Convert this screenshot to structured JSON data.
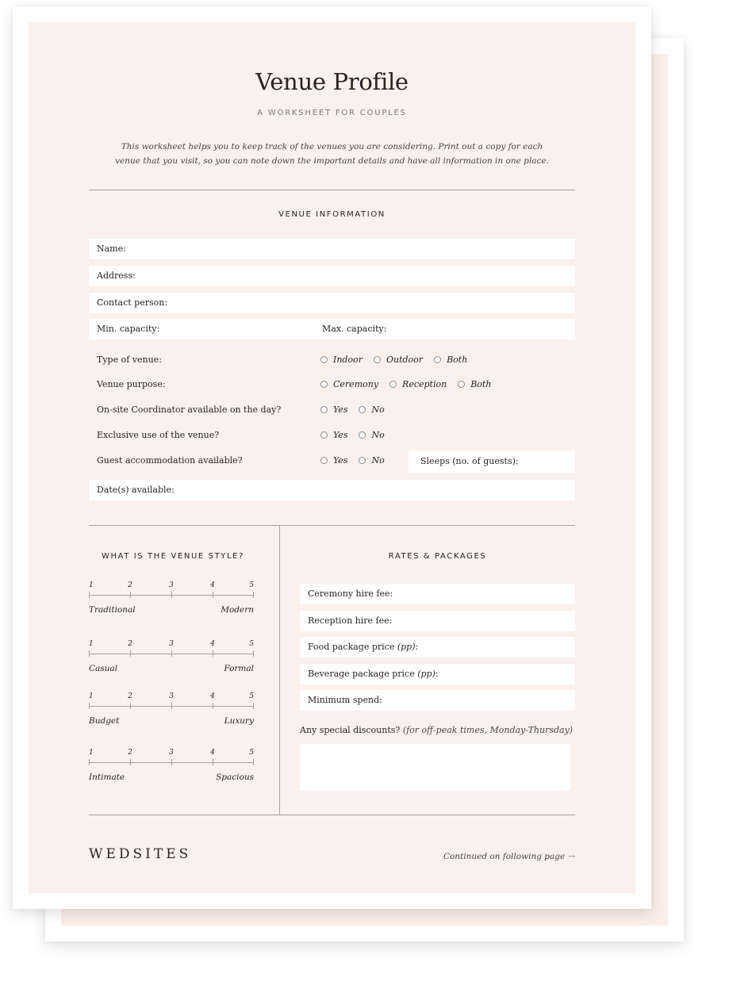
{
  "document": {
    "title": "Venue Profile",
    "subtitle": "A WORKSHEET FOR COUPLES",
    "intro": "This worksheet helps you to keep track of the venues you are considering. Print out a copy for each venue that you visit, so you can note down the important details and have all information in one place."
  },
  "venue_information": {
    "heading": "VENUE INFORMATION",
    "fields": {
      "name": "Name:",
      "address": "Address:",
      "contact_person": "Contact person:",
      "min_capacity": "Min. capacity:",
      "max_capacity": "Max. capacity:",
      "sleeps": "Sleeps (no. of guests):",
      "dates_available": "Date(s) available:"
    },
    "questions": [
      {
        "label": "Type of venue:",
        "options": [
          "Indoor",
          "Outdoor",
          "Both"
        ]
      },
      {
        "label": "Venue purpose:",
        "options": [
          "Ceremony",
          "Reception",
          "Both"
        ]
      },
      {
        "label": "On-site Coordinator available on the day?",
        "options": [
          "Yes",
          "No"
        ]
      },
      {
        "label": "Exclusive use of the venue?",
        "options": [
          "Yes",
          "No"
        ]
      },
      {
        "label": "Guest accommodation available?",
        "options": [
          "Yes",
          "No"
        ]
      }
    ]
  },
  "venue_style": {
    "heading": "WHAT IS THE VENUE STYLE?",
    "scale_numbers": [
      "1",
      "2",
      "3",
      "4",
      "5"
    ],
    "scales": [
      {
        "left": "Traditional",
        "right": "Modern"
      },
      {
        "left": "Casual",
        "right": "Formal"
      },
      {
        "left": "Budget",
        "right": "Luxury"
      },
      {
        "left": "Intimate",
        "right": "Spacious"
      }
    ]
  },
  "rates": {
    "heading": "RATES & PACKAGES",
    "fields": {
      "ceremony_fee": "Ceremony hire fee:",
      "reception_fee": "Reception hire fee:",
      "food_price": "Food package price",
      "food_price_note": "(pp)",
      "beverage_price": "Beverage package price",
      "beverage_price_note": "(pp)",
      "minimum_spend": "Minimum spend:"
    },
    "discounts_label": "Any special discounts?",
    "discounts_note": "(for off-peak times, Monday-Thursday)"
  },
  "footer": {
    "logo": "WEDSITES",
    "continued": "Continued on following page",
    "arrow": "→"
  },
  "colors": {
    "panel_background": "#fcf0ec",
    "rule": "#a89e9e",
    "text": "#2a2222"
  }
}
